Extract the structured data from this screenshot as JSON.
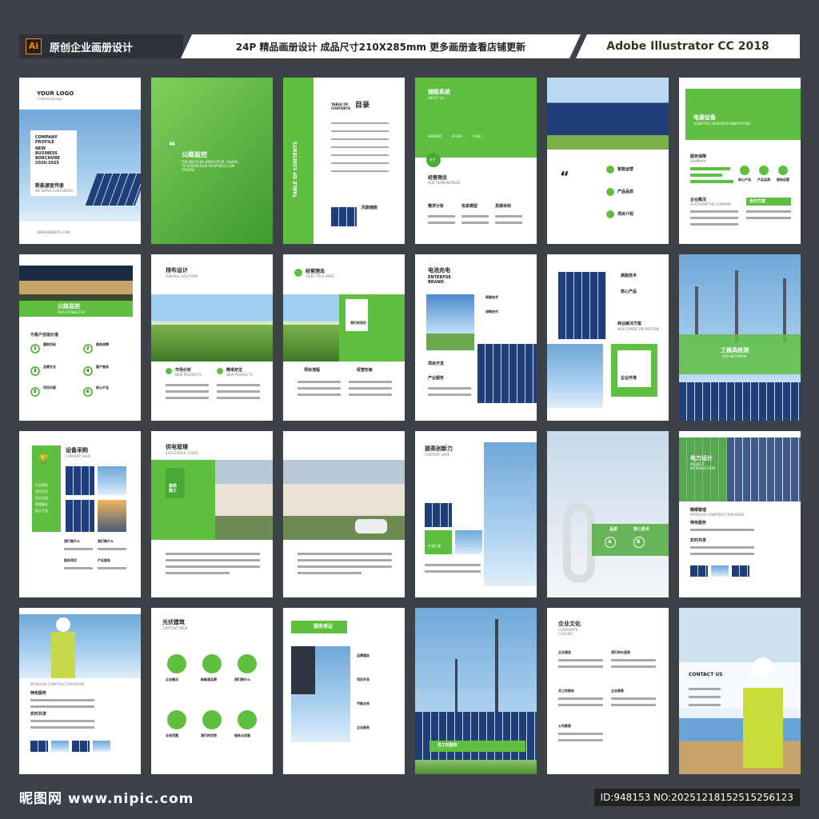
{
  "header": {
    "app_badge": "Ai",
    "left_title": "原创企业画册设计",
    "center_title": "24P 精品画册设计  成品尺寸210X285mm  更多画册查看店铺更新",
    "right_title": "Adobe Illustrator CC 2018"
  },
  "pages": {
    "p1": {
      "logo": "YOUR LOGO",
      "logo_sub": "Creative Design",
      "profile": "COMPANY\nPROFILE",
      "business": "NEW\nBUSINESS\nBORCHURE\n2020-2025",
      "cn_title": "新能源宣传册",
      "cn_sub": "WE SERVE CUSTOMERS",
      "website": "WWW.WEBSITE.COM"
    },
    "p2": {
      "title": "公路监控",
      "latin": "ITIO NECULBA DEBECATUR. ALIBUIL\nTE GODON SUM ARUPTIBUS CUM\nVOLORE"
    },
    "p3": {
      "side": "TABLE OF CONTENTS",
      "toc_en": "TABLE OF\nCONTENTS",
      "toc_cn": "目录",
      "caption": "风能储能"
    },
    "p4": {
      "title": "储能系统",
      "sub": "ABOUT US",
      "tabs": [
        "WORKER",
        "STUDY",
        "CASE"
      ],
      "badge": "关于",
      "worker": "经营理念",
      "worker_en": "OUR TEAM WORKER",
      "cols": [
        "需求分析",
        "信息模型",
        "发展目标"
      ]
    },
    "p5": {
      "quote": "“",
      "items": [
        "智能运营",
        "产品品质",
        "项目介绍"
      ]
    },
    "p6": {
      "title": "电源设备",
      "title_en": "SCIENTIFIC RESEARCH INNOVATION",
      "service": "服务保障",
      "service_en": "SUMMARY",
      "c1": "核心产品",
      "c2": "产品品质",
      "c3": "服务运营",
      "company": "企业概况",
      "company_en": "PLATFORM THE COMPANY",
      "plan": "合作方案"
    },
    "p7": {
      "title": "公路监控",
      "title_en": "OUR STRENGTHS",
      "head": "为客户创造价值",
      "items": [
        "建筑目标",
        "服务保障",
        "品牌文化",
        "客户服务",
        "项目内容",
        "核心产品"
      ],
      "nums": [
        "1",
        "2",
        "3",
        "4",
        "5",
        "6"
      ]
    },
    "p8": {
      "title": "排布设计",
      "title_en": "OVERALL SOLUTION",
      "a": "市场分析",
      "a_en": "NEW PRODUCTS",
      "b": "精准定位",
      "b_en": "NEW PRODUCTS"
    },
    "p9": {
      "title": "经营理念",
      "title_en": "YOUR TITLE HERE",
      "box": "我们的项目",
      "a": "项目流程",
      "b": "经营形象"
    },
    "p10": {
      "title": "电池充电",
      "title_en": "ENTERPSE\nBRAND",
      "a": "高能技术",
      "b": "战略合作",
      "c": "项目开发",
      "d": "产业服务"
    },
    "p11": {
      "a": "高能技术",
      "b": "核心产品",
      "c": "商业解决方案",
      "c_en": "INVESTMENT PROMOTION",
      "box": "企业环境"
    },
    "p12": {
      "title": "工器具检测",
      "title_en": "OUR NETWORK"
    },
    "p13": {
      "title": "设备采购",
      "title_en": "CONTENT HERE",
      "list": [
        "产品资料",
        "项目开发",
        "状况记录",
        "管理服务",
        "核心产品"
      ],
      "a": "我们做什么",
      "b": "我们做什么",
      "c": "服务项目",
      "d": "产业服务"
    },
    "p14": {
      "title": "供电管理",
      "title_en": "SUCCESSFUL CASES",
      "box": "高效\n施工"
    },
    "p16": {
      "title": "提高创新力",
      "title_en": "CONTENT HERE",
      "a": "产业扩展"
    },
    "p17": {
      "a": "品质",
      "b": "核心技术",
      "c": "A",
      "d": "B"
    },
    "p18": {
      "title": "电力设计",
      "title_en": "PROJECT\nINTRODUCTION",
      "a": "精细管理",
      "a_en": "MODULAR CONSTRUCTION MODE",
      "b": "特色服务",
      "c": "实时共享"
    },
    "p19": {
      "a_en": "MODULAR CONSTRUCTION MODE",
      "b": "特色服务",
      "c": "实时共享"
    },
    "p20": {
      "title": "光伏建筑",
      "title_en": "CONTENT HERE",
      "icons": [
        "企业概况",
        "新能源品牌",
        "我们做什么",
        "业务范围",
        "我们的优势",
        "服务与发展"
      ]
    },
    "p21": {
      "title": "服务保证",
      "items": [
        "品牌理念",
        "项目开发",
        "节能业务",
        "企业服务"
      ]
    },
    "p22": {
      "caption": "员工的服务"
    },
    "p23": {
      "title": "企业文化",
      "title_en": "CORPORATE\nCULTURE",
      "items": [
        "企业理念",
        "我们的价值观",
        "员工的服务",
        "企业愿景",
        "公司愿景"
      ]
    },
    "p24": {
      "contact": "CONTACT US"
    }
  },
  "footer": {
    "logo": "昵图网 www.nipic.com",
    "id": "ID:948153 NO:20251218152515256123"
  }
}
